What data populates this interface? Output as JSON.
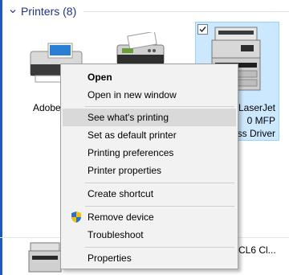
{
  "section": {
    "title": "Printers (8)"
  },
  "devices": [
    {
      "label": "Adobe",
      "icon": "printer-icon"
    },
    {
      "label": "",
      "icon": "fax-icon"
    },
    {
      "label_lines": [
        "LaserJet",
        "0 MFP",
        "ss Driver"
      ],
      "icon": "mfp-printer-icon",
      "selected": true
    }
  ],
  "bottom_row": {
    "text": "CL6 Cl..."
  },
  "context_menu": {
    "items": [
      {
        "label": "Open",
        "bold": true
      },
      {
        "label": "Open in new window"
      },
      {
        "label": "See what's printing",
        "highlighted": true
      },
      {
        "label": "Set as default printer"
      },
      {
        "label": "Printing preferences"
      },
      {
        "label": "Printer properties"
      },
      {
        "label": "Create shortcut"
      },
      {
        "label": "Remove device",
        "icon": "uac-shield-icon"
      },
      {
        "label": "Troubleshoot"
      },
      {
        "label": "Properties"
      }
    ]
  },
  "colors": {
    "header_text": "#1e3287",
    "selection_bg": "#cce8ff",
    "selection_border": "#99d1ff",
    "menu_bg": "#f2f2f2",
    "menu_highlight": "#d9d9d9"
  }
}
